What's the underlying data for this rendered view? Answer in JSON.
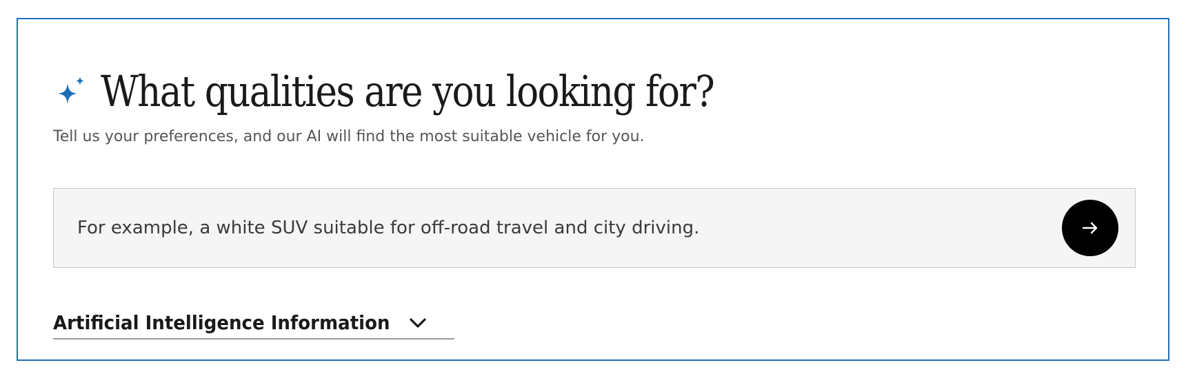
{
  "colors": {
    "frame_border": "#1f6fb8",
    "sparkle": "#1f6fb8",
    "button_bg": "#000000"
  },
  "header": {
    "icon": "sparkle-icon",
    "title": "What qualities are you looking for?",
    "subtitle": "Tell us your preferences, and our AI will find the most suitable vehicle for you."
  },
  "search": {
    "value": "",
    "placeholder": "For example, a white SUV suitable for off-road travel and city driving.",
    "submit_icon": "arrow-right-icon"
  },
  "ai_info": {
    "label": "Artificial Intelligence Information",
    "icon": "chevron-down-icon"
  }
}
